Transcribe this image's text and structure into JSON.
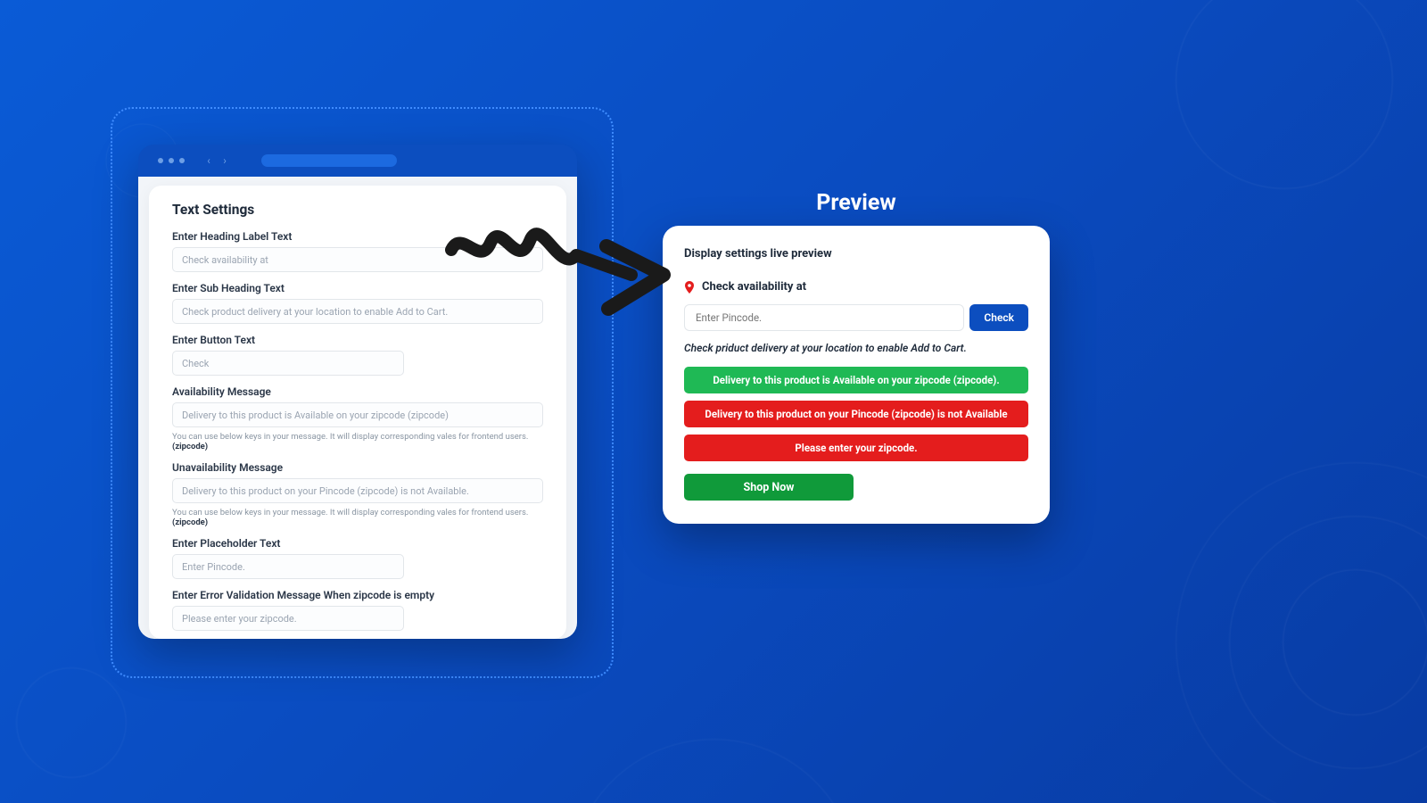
{
  "settings": {
    "title": "Text Settings",
    "fields": {
      "heading": {
        "label": "Enter Heading Label Text",
        "value": "Check availability at"
      },
      "subheading": {
        "label": "Enter Sub Heading Text",
        "value": "Check product delivery at your location to enable Add to Cart."
      },
      "button": {
        "label": "Enter Button Text",
        "value": "Check"
      },
      "availability": {
        "label": "Availability Message",
        "value": "Delivery to this product is Available on your zipcode (zipcode)",
        "helper": "You can use below keys in your message. It will display corresponding vales for frontend users.",
        "helper_key": "(zipcode)"
      },
      "unavailability": {
        "label": "Unavailability Message",
        "value": "Delivery to this product on your Pincode (zipcode) is not Available.",
        "helper": "You can use below keys in your message. It will display corresponding vales for frontend users.",
        "helper_key": "(zipcode)"
      },
      "placeholder": {
        "label": "Enter Placeholder Text",
        "value": "Enter Pincode."
      },
      "error": {
        "label": "Enter Error Validation Message When zipcode is empty",
        "value": "Please enter your zipcode."
      }
    }
  },
  "preview": {
    "title": "Preview",
    "heading": "Display settings live preview",
    "check_label": "Check availability at",
    "input_placeholder": "Enter Pincode.",
    "check_button": "Check",
    "sub_text": "Check priduct delivery at your location to enable Add to Cart.",
    "msg_available": "Delivery to this product is Available on your zipcode (zipcode).",
    "msg_unavailable": "Delivery to this product on your Pincode (zipcode) is not Available",
    "msg_error": "Please enter your zipcode.",
    "shop_button": "Shop Now"
  },
  "colors": {
    "primary": "#0c4ebf",
    "success": "#1fb955",
    "danger": "#e41d1d",
    "shop": "#109a3a"
  }
}
